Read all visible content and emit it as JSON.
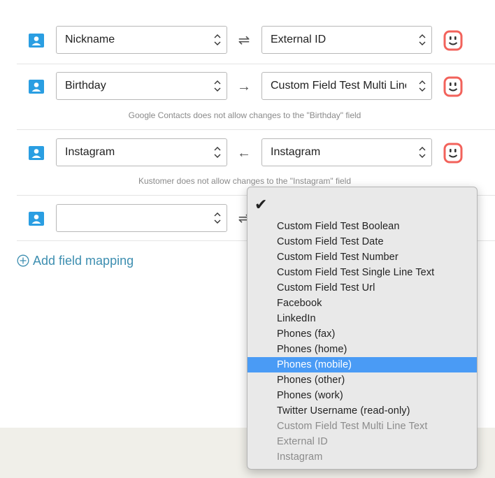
{
  "rows": [
    {
      "left": "Nickname",
      "arrow": "⇌",
      "right": "External ID",
      "note": ""
    },
    {
      "left": "Birthday",
      "arrow": "→",
      "right": "Custom Field Test Multi Line Text",
      "note": "Google Contacts does not allow changes to the \"Birthday\" field"
    },
    {
      "left": "Instagram",
      "arrow": "←",
      "right": "Instagram",
      "note": "Kustomer does not allow changes to the \"Instagram\" field"
    },
    {
      "left": "",
      "arrow": "⇌",
      "right": "",
      "note": ""
    }
  ],
  "add_mapping_label": "Add field mapping",
  "dropdown": {
    "checkmark": "✔",
    "items": [
      {
        "label": "Custom Field Test Boolean",
        "state": "normal"
      },
      {
        "label": "Custom Field Test Date",
        "state": "normal"
      },
      {
        "label": "Custom Field Test Number",
        "state": "normal"
      },
      {
        "label": "Custom Field Test Single Line Text",
        "state": "normal"
      },
      {
        "label": "Custom Field Test Url",
        "state": "normal"
      },
      {
        "label": "Facebook",
        "state": "normal"
      },
      {
        "label": "LinkedIn",
        "state": "normal"
      },
      {
        "label": "Phones (fax)",
        "state": "normal"
      },
      {
        "label": "Phones (home)",
        "state": "normal"
      },
      {
        "label": "Phones (mobile)",
        "state": "selected"
      },
      {
        "label": "Phones (other)",
        "state": "normal"
      },
      {
        "label": "Phones (work)",
        "state": "normal"
      },
      {
        "label": "Twitter Username (read-only)",
        "state": "normal"
      },
      {
        "label": "Custom Field Test Multi Line Text",
        "state": "disabled"
      },
      {
        "label": "External ID",
        "state": "disabled"
      },
      {
        "label": "Instagram",
        "state": "disabled"
      }
    ]
  },
  "icons": {
    "left_source": "google-contacts-icon",
    "right_source": "kustomer-icon",
    "select_chevrons": "chevron-up-down-icon",
    "add": "plus-circle-icon"
  },
  "colors": {
    "google_blue": "#2a9ee2",
    "kustomer_red": "#f2625b",
    "link_blue": "#3d8eb0",
    "menu_highlight": "#4a9bf5",
    "footer_band": "#f0efe9"
  }
}
